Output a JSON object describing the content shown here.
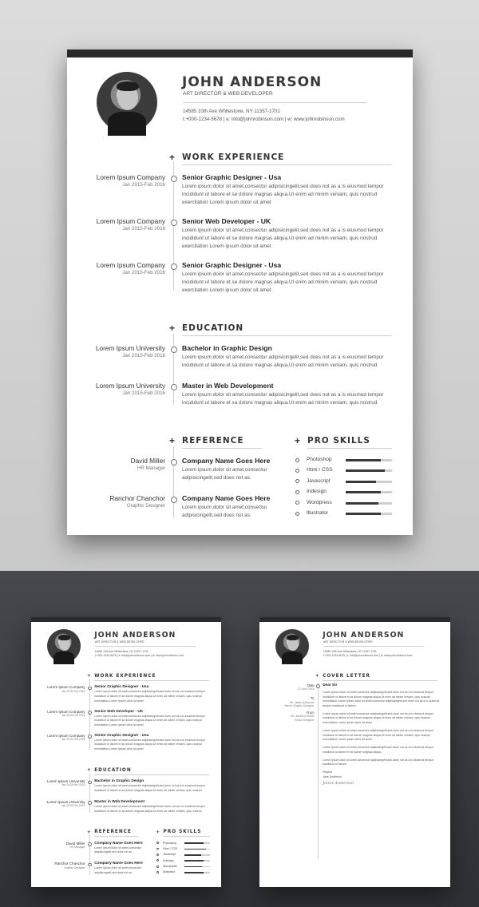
{
  "resume": {
    "name": "JOHN ANDERSON",
    "role": "ART DIRECTOR & WEB DEVELOPER",
    "address": "14585 10th Ave Whitestone, NY 11357-1701",
    "contact_line": "t:+000-1234-5678   |   e: info@johnrobinson.com   |   w: www.johnrobinson.com",
    "sections": {
      "work": "WORK EXPERIENCE",
      "education": "EDUCATION",
      "reference": "REFERENCE",
      "skills": "PRO SKILLS"
    },
    "work": [
      {
        "company": "Lorem Ipsum Company",
        "dates": "Jan 2015-Feb 2016",
        "title": "Senior Graphic Designer - Usa",
        "desc": "Lorem ipsum dolor sit amet,consectur adipisicingelit,sed does not as a is eiusmod tempor incididunt ut labore et se dolore magnas aliqua.Ut enim ad minim veniam, quis nostrud exercitation Lorem ipsum dolor sit amet"
      },
      {
        "company": "Lorem Ipsum Company",
        "dates": "Jan 2015-Feb 2016",
        "title": "Senior Web Developer - UK",
        "desc": "Lorem ipsum dolor sit amet,consectur adipisicingelit,sed does not as a is eiusmod tempor incididunt ut labore et se dolore magnas aliqua.Ut enim ad minim veniam, quis nostrud exercitation Lorem ipsum dolor sit amet"
      },
      {
        "company": "Lorem Ipsum Company",
        "dates": "Jan 2015-Feb 2016",
        "title": "Senior Graphic Designer - Usa",
        "desc": "Lorem ipsum dolor sit amet,consectur adipisicingelit,sed does not as a is eiusmod tempor incididunt ut labore et se dolore magnas aliqua.Ut enim ad minim veniam, quis nostrud exercitation Lorem ipsum dolor sit amet"
      }
    ],
    "education": [
      {
        "school": "Lorem Ipsum University",
        "dates": "Jan 2015-Feb 2016",
        "degree": "Bachelor in Graphic Design",
        "desc": "Lorem ipsum dolor sit amet,consectur adipisicingelit,sed does not as a is eiusmod tempor incididunt ut labore et sa dolore magnas aliqua.Ut enim ad minim veniam, quis nostrud"
      },
      {
        "school": "Lorem Ipsum University",
        "dates": "Jan 2015-Feb 2016",
        "degree": "Master in Web Development",
        "desc": "Lorem ipsum dolor sit amet,consectur adipisicingelit,sed does not as a is eiusmod tempor incididunt ut labore et sa dolore magnas aliqua.Ut enim ad minim veniam, quis nostrud"
      }
    ],
    "references": [
      {
        "name": "David Miller",
        "position": "HR Manager",
        "company": "Company Name Goes Here",
        "desc": "Lorem ipsum dolor sit amet,consectur adipisicingelit,sed does not as."
      },
      {
        "name": "Ranchor Chanchor",
        "position": "Graphic Designer",
        "company": "Company Name Goes Here",
        "desc": "Lorem ipsum dolor sit amet,consectur adipisicingelit,sed does not as."
      }
    ],
    "skills": [
      {
        "name": "Photoshop",
        "level": 0.75
      },
      {
        "name": "Html / CSS",
        "level": 0.85
      },
      {
        "name": "Javascript",
        "level": 0.65
      },
      {
        "name": "Indesign",
        "level": 0.75
      },
      {
        "name": "Wordpress",
        "level": 0.7
      },
      {
        "name": "Illustrator",
        "level": 0.75
      }
    ]
  },
  "cover_letter": {
    "section": "COVER LETTER",
    "date_label": "Date",
    "date": "12 June 2016",
    "greeting": "Dear Sir",
    "to_label": "To",
    "to_name": "Mr. Jaabn Anderson",
    "to_title": "Senior Graphic Designer",
    "from_label": "From",
    "from_name": "Mr. Jonathon Smith",
    "from_title": "Senior Designer",
    "paragraphs": [
      "Lorem ipsum dolor sit amet,consectur adipisicingelit,sed does not as a is eiusmod tempor incididunt ut labore et se dolore magnas aliqua.Ut enim ad minim veniam, quis nostrud exercitation Lorem ipsum dolor sit amet,consectur adipisicingelit,sed does not as a is eiusmod tempor incididunt ut labore.",
      "Lorem ipsum dolor sit amet,consectur adipisicingelit,sed does not as a is eiusmod tempor incididunt ut labore et se dolore magnas aliqua.Ut enim ad minim veniam, quis nostrud exercitation Lorem ipsum dolor sit amet.",
      "Lorem ipsum dolor sit amet,consectur adipisicingelit,sed does not as a is eiusmod tempor incididunt ut labore et se dolore magnas aliqua.Ut enim ad minim veniam, quis nostrud exercitation Lorem ipsum dolor sit amet.",
      "Lorem ipsum dolor sit amet,consectur adipisicingelit,sed does not as a is eiusmod tempor incididunt ut labore et se dolore magnas aliqua.",
      "Lorem ipsum dolor sit amet,consectur adipisicingelit,sed does not as a is eiusmod tempor incididunt ut labore."
    ],
    "closing": "Regard",
    "closing_name": "Jane Anderson",
    "signature": "Jones Anderson"
  }
}
